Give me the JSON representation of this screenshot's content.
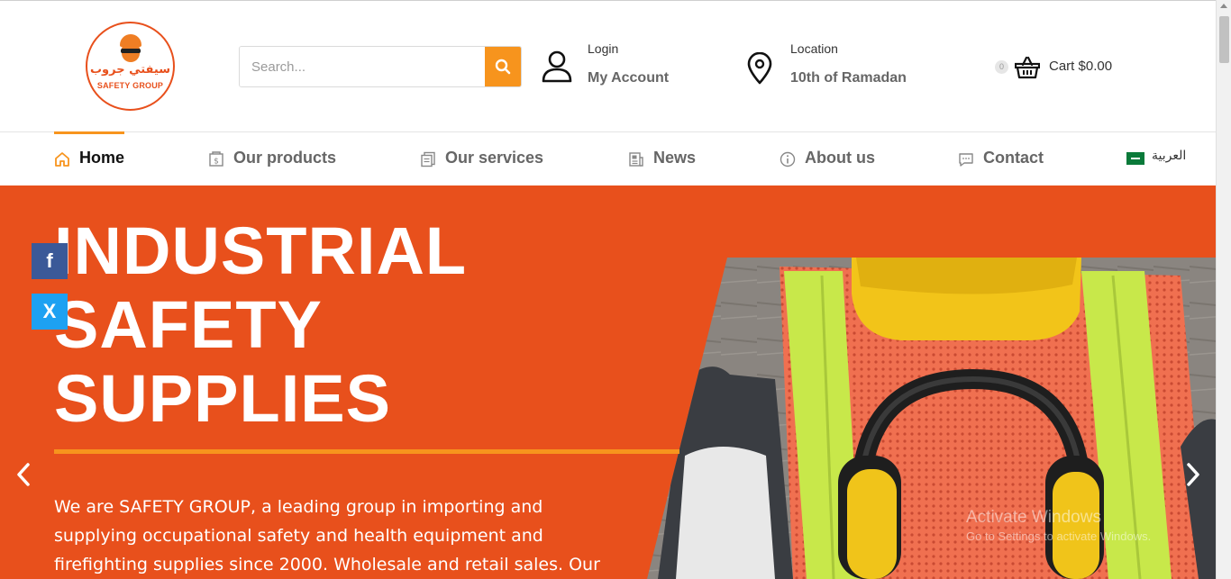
{
  "logo": {
    "arabic": "سيفتي جروب",
    "english": "SAFETY GROUP"
  },
  "search": {
    "placeholder": "Search...",
    "value": ""
  },
  "account": {
    "small": "Login",
    "big": "My Account",
    "icon": "user-icon"
  },
  "location": {
    "small": "Location",
    "big": "10th of Ramadan",
    "icon": "map-pin-icon"
  },
  "cart": {
    "count": "0",
    "label": "Cart $0.00",
    "icon": "basket-icon"
  },
  "nav": {
    "items": [
      {
        "label": "Home",
        "icon": "home-icon"
      },
      {
        "label": "Our products",
        "icon": "products-icon"
      },
      {
        "label": "Our services",
        "icon": "services-icon"
      },
      {
        "label": "News",
        "icon": "news-icon"
      },
      {
        "label": "About us",
        "icon": "info-icon"
      },
      {
        "label": "Contact",
        "icon": "chat-icon"
      }
    ],
    "language": "العربية"
  },
  "hero": {
    "title_lines": [
      "INDUSTRIAL",
      "SAFETY",
      "SUPPLIES"
    ],
    "description": "We are SAFETY GROUP, a leading group in importing and supplying occupational safety and health equipment and firefighting supplies since 2000. Wholesale and retail sales. Our"
  },
  "social": {
    "facebook": "f",
    "twitter": "X"
  },
  "watermark": {
    "line1": "Activate Windows",
    "line2": "Go to Settings to activate Windows."
  },
  "colors": {
    "brand_orange": "#e8501c",
    "accent": "#f7941d"
  }
}
